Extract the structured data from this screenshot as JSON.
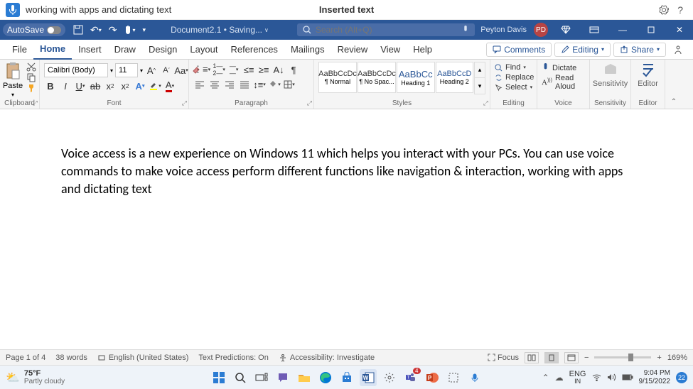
{
  "voice_bar": {
    "listening_text": "working with apps and dictating text",
    "feedback": "Inserted text"
  },
  "title_bar": {
    "autosave_label": "AutoSave",
    "doc_name": "Document2.1 • Saving...",
    "search_placeholder": "Search (Alt+Q)",
    "user_name": "Peyton Davis",
    "user_initials": "PD"
  },
  "tabs": {
    "file": "File",
    "home": "Home",
    "insert": "Insert",
    "draw": "Draw",
    "design": "Design",
    "layout": "Layout",
    "references": "References",
    "mailings": "Mailings",
    "review": "Review",
    "view": "View",
    "help": "Help"
  },
  "ribbon_right": {
    "comments": "Comments",
    "editing": "Editing",
    "share": "Share"
  },
  "ribbon": {
    "clipboard": {
      "paste": "Paste",
      "label": "Clipboard"
    },
    "font": {
      "name": "Calibri (Body)",
      "size": "11",
      "label": "Font"
    },
    "paragraph": {
      "label": "Paragraph"
    },
    "styles": {
      "label": "Styles",
      "items": [
        {
          "preview": "AaBbCcDc",
          "name": "¶ Normal"
        },
        {
          "preview": "AaBbCcDc",
          "name": "¶ No Spac..."
        },
        {
          "preview": "AaBbCc",
          "name": "Heading 1"
        },
        {
          "preview": "AaBbCcD",
          "name": "Heading 2"
        }
      ]
    },
    "editing": {
      "find": "Find",
      "replace": "Replace",
      "select": "Select",
      "label": "Editing"
    },
    "voice": {
      "dictate": "Dictate",
      "read_aloud": "Read Aloud",
      "label": "Voice"
    },
    "sensitivity": {
      "btn": "Sensitivity",
      "label": "Sensitivity"
    },
    "editor": {
      "btn": "Editor",
      "label": "Editor"
    }
  },
  "document": {
    "text": "Voice access is a new experience on Windows 11 which helps you interact with your PCs. You can use voice commands to make voice access perform different functions like navigation & interaction, working with apps and dictating text"
  },
  "status": {
    "page": "Page 1 of 4",
    "words": "38 words",
    "language": "English (United States)",
    "predictions": "Text Predictions: On",
    "accessibility": "Accessibility: Investigate",
    "focus": "Focus",
    "zoom": "169%"
  },
  "taskbar": {
    "temp": "75°F",
    "weather": "Partly cloudy",
    "lang1": "ENG",
    "lang2": "IN",
    "time": "9:04 PM",
    "date": "9/15/2022",
    "notif_count": "22"
  }
}
